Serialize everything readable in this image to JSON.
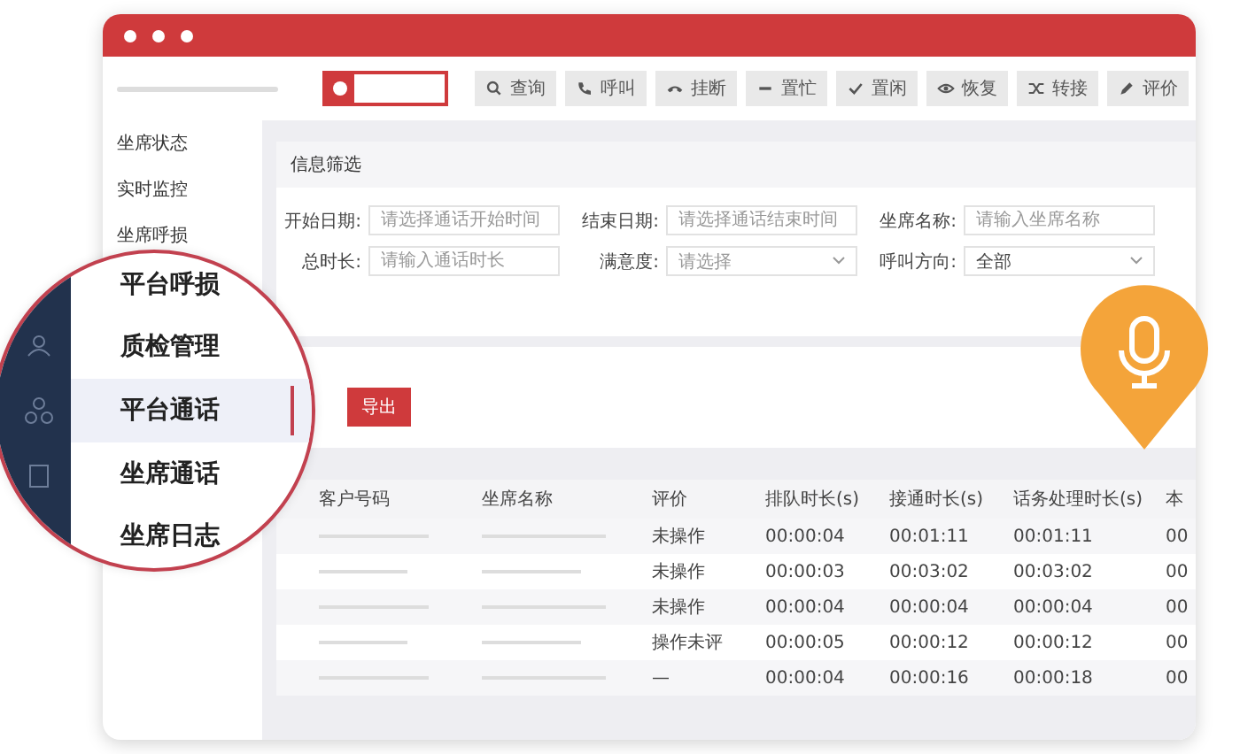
{
  "toolbar": {
    "buttons": [
      {
        "kind": "search",
        "label": "查询"
      },
      {
        "kind": "phone",
        "label": "呼叫"
      },
      {
        "kind": "hangup",
        "label": "挂断"
      },
      {
        "kind": "minus",
        "label": "置忙"
      },
      {
        "kind": "check",
        "label": "置闲"
      },
      {
        "kind": "eye",
        "label": "恢复"
      },
      {
        "kind": "shuffle",
        "label": "转接"
      },
      {
        "kind": "pencil",
        "label": "评价"
      }
    ]
  },
  "sidebar": {
    "items": [
      {
        "label": "坐席状态"
      },
      {
        "label": "实时监控"
      },
      {
        "label": "坐席呼损"
      }
    ]
  },
  "filter": {
    "title": "信息筛选",
    "fields": [
      {
        "kind": "input",
        "label": "开始日期:",
        "placeholder": "请选择通话开始时间"
      },
      {
        "kind": "input",
        "label": "结束日期:",
        "placeholder": "请选择通话结束时间"
      },
      {
        "kind": "input",
        "label": "坐席名称:",
        "placeholder": "请输入坐席名称"
      },
      {
        "kind": "input",
        "label": "总时长:",
        "placeholder": "请输入通话时长"
      },
      {
        "kind": "select",
        "label": "满意度:",
        "placeholder": "请选择"
      },
      {
        "kind": "select",
        "label": "呼叫方向:",
        "value": "全部"
      }
    ]
  },
  "export_button": "导出",
  "table": {
    "columns": [
      "客户号码",
      "坐席名称",
      "评价",
      "排队时长(s)",
      "接通时长(s)",
      "话务处理时长(s)",
      "本"
    ],
    "rows": [
      {
        "rating": "未操作",
        "queue": "00:00:04",
        "connect": "00:01:11",
        "handle": "00:01:11",
        "column_7": "00"
      },
      {
        "rating": "未操作",
        "queue": "00:00:03",
        "connect": "00:03:02",
        "handle": "00:03:02",
        "column_7": "00"
      },
      {
        "rating": "未操作",
        "queue": "00:00:04",
        "connect": "00:00:04",
        "handle": "00:00:04",
        "column_7": "00"
      },
      {
        "rating": "操作未评",
        "queue": "00:00:05",
        "connect": "00:00:12",
        "handle": "00:00:12",
        "column_7": "00"
      },
      {
        "rating": "—",
        "queue": "00:00:04",
        "connect": "00:00:16",
        "handle": "00:00:18",
        "column_7": "00"
      }
    ]
  },
  "magnifier": {
    "items": [
      {
        "label": "平台呼损",
        "selected": false
      },
      {
        "label": "质检管理",
        "selected": false
      },
      {
        "label": "平台通话",
        "selected": true
      },
      {
        "label": "坐席通话",
        "selected": false
      },
      {
        "label": "坐席日志",
        "selected": false
      }
    ]
  }
}
